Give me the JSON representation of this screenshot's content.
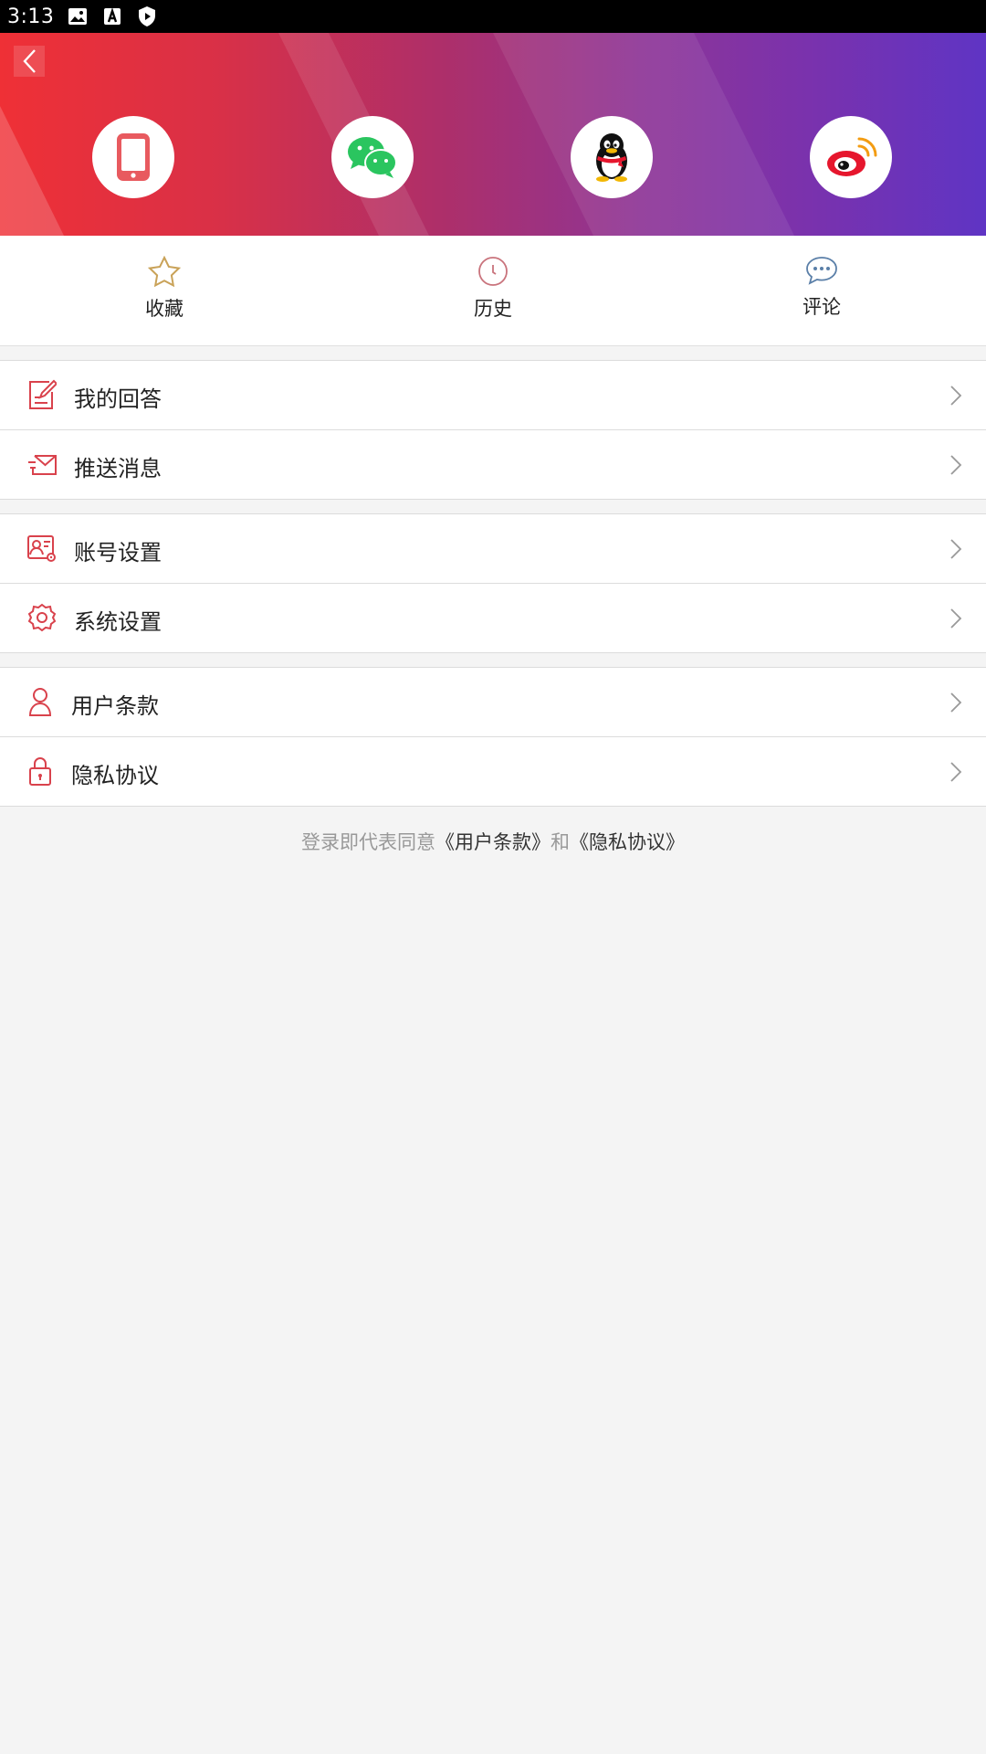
{
  "status_bar": {
    "time": "3:13",
    "icons": [
      "image-icon",
      "font-a-icon",
      "shield-play-icon"
    ]
  },
  "header": {
    "back_icon": "chevron-left-icon",
    "gradient": [
      "#ef3036",
      "#ad2f6a",
      "#5f34c4"
    ],
    "login_methods": [
      {
        "name": "phone",
        "icon": "phone-icon",
        "color": "#e85a5f"
      },
      {
        "name": "wechat",
        "icon": "wechat-icon",
        "color": "#2ac55f"
      },
      {
        "name": "qq",
        "icon": "qq-penguin-icon",
        "color": "#000000"
      },
      {
        "name": "weibo",
        "icon": "weibo-icon",
        "color": "#e6162d"
      }
    ]
  },
  "quick_actions": [
    {
      "label": "收藏",
      "icon": "star-icon",
      "color": "#c9a258"
    },
    {
      "label": "历史",
      "icon": "clock-icon",
      "color": "#c9737c"
    },
    {
      "label": "评论",
      "icon": "comment-bubble-icon",
      "color": "#5a7fa8"
    }
  ],
  "menu": {
    "group1": [
      {
        "label": "我的回答",
        "icon": "edit-answer-icon"
      },
      {
        "label": "推送消息",
        "icon": "envelope-send-icon"
      }
    ],
    "group2": [
      {
        "label": "账号设置",
        "icon": "account-settings-icon"
      },
      {
        "label": "系统设置",
        "icon": "gear-icon"
      }
    ],
    "group3": [
      {
        "label": "用户条款",
        "icon": "user-icon"
      },
      {
        "label": "隐私协议",
        "icon": "lock-icon"
      }
    ],
    "accent_color": "#d9424c"
  },
  "footer": {
    "prefix": "登录即代表同意",
    "terms_link": "《用户条款》",
    "conjunction": "和",
    "privacy_link": "《隐私协议》"
  }
}
